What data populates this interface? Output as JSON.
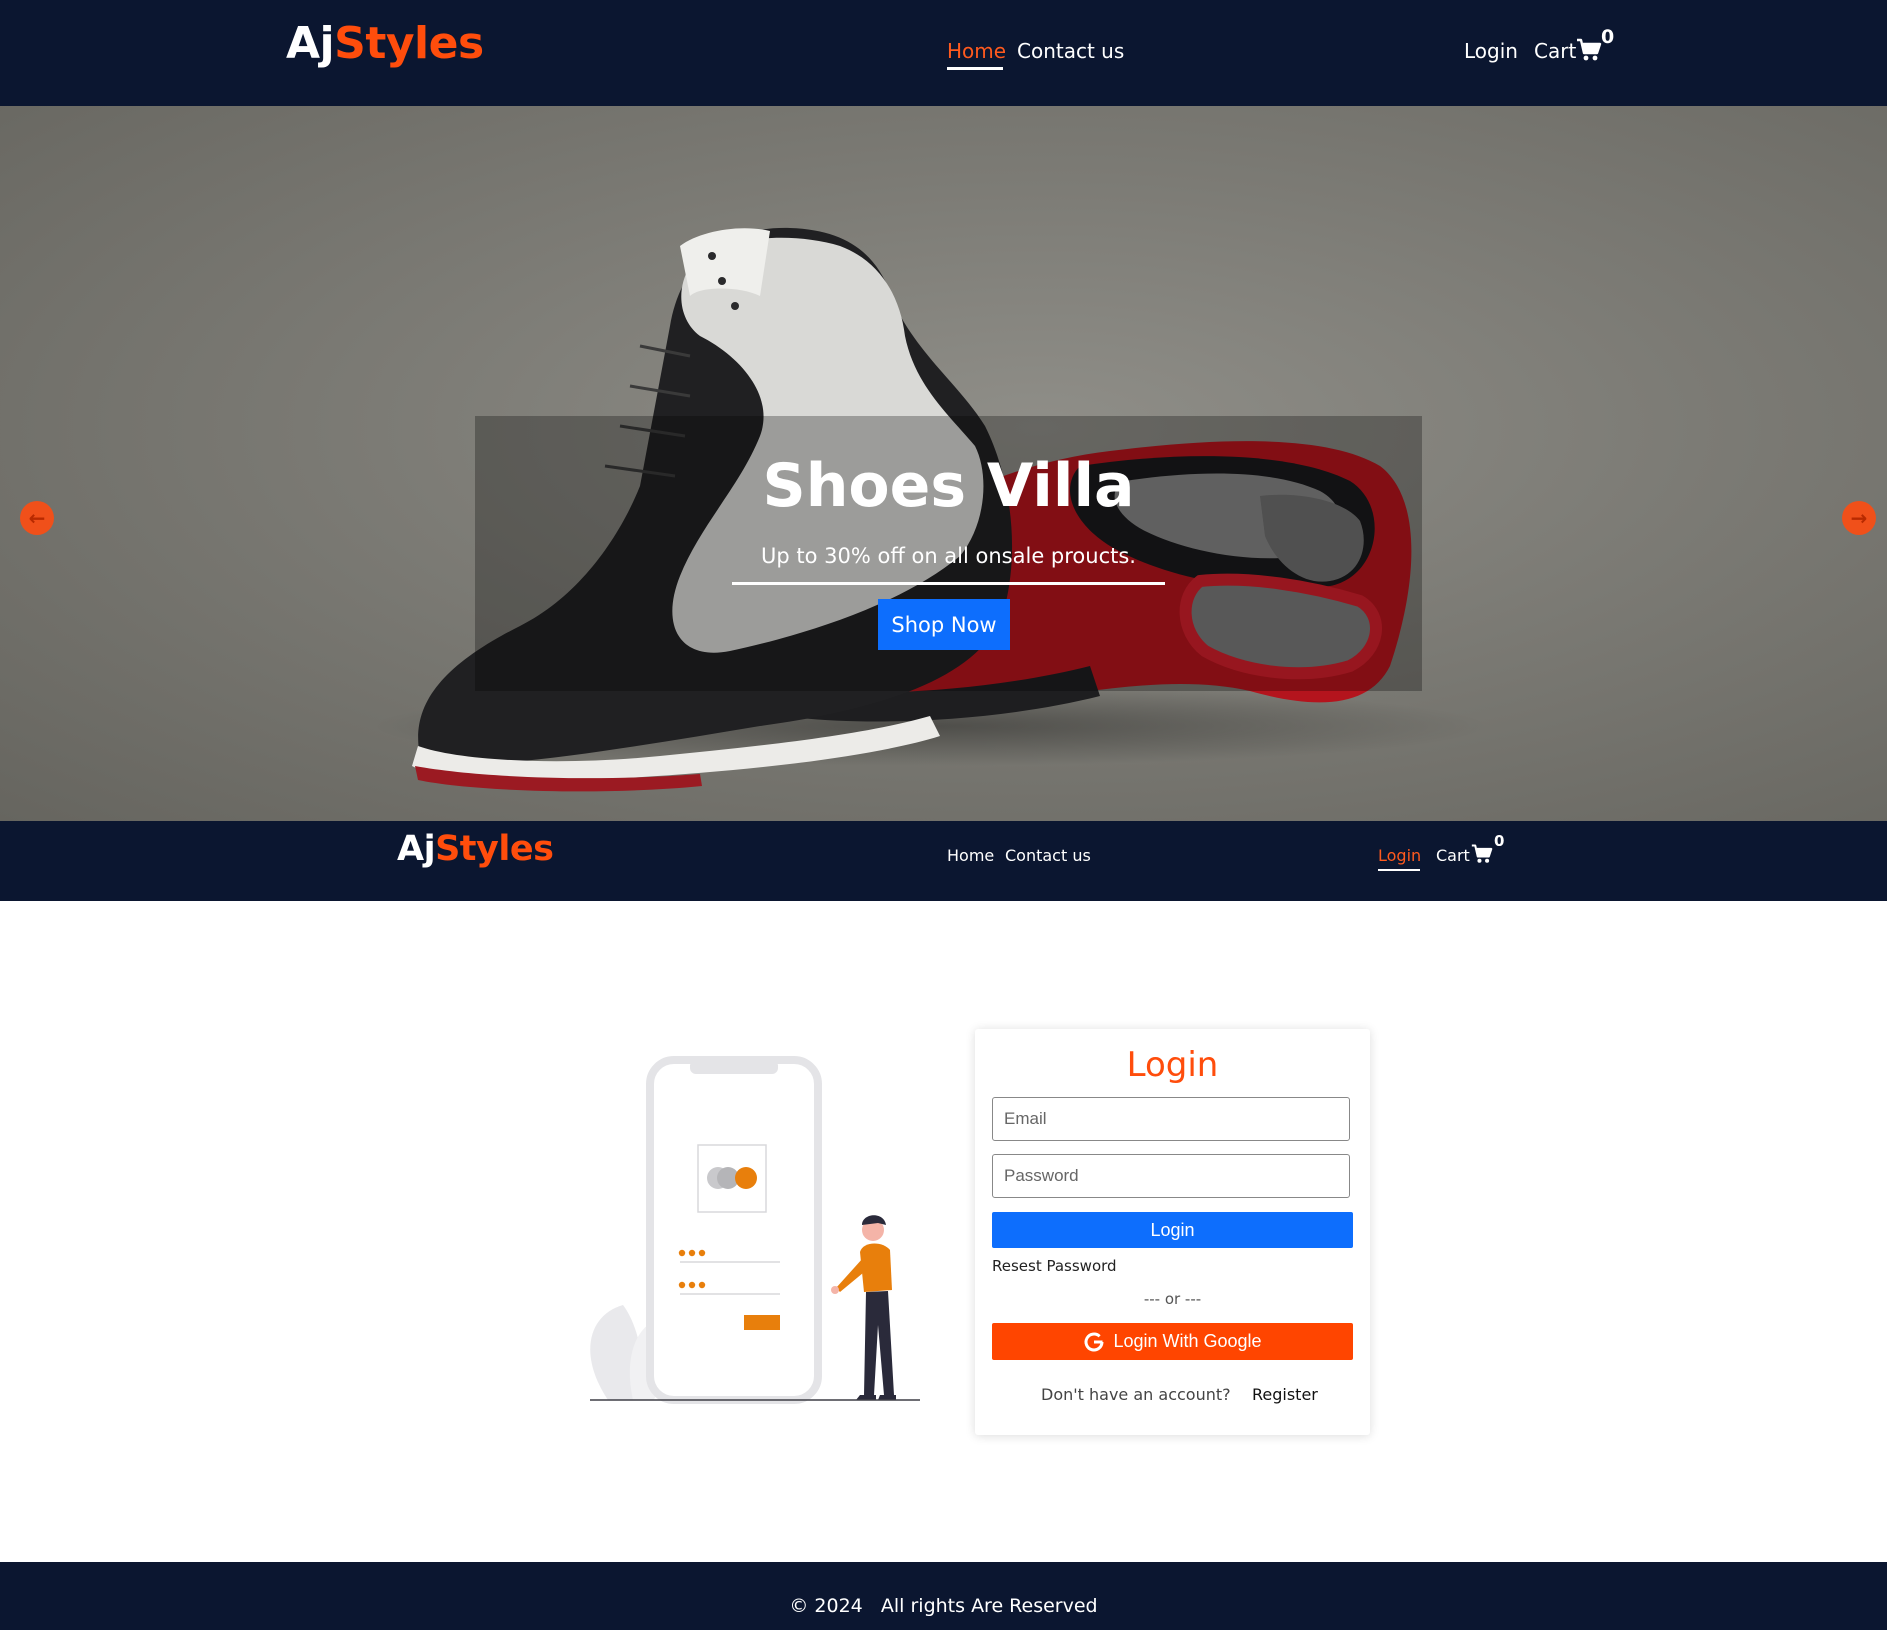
{
  "top_nav": {
    "brand_part1": "Aj",
    "brand_part2": "Styles",
    "links": [
      "Home",
      "Contact us"
    ],
    "login": "Login",
    "cart": "Cart",
    "cart_count": "0",
    "active_link": "Home"
  },
  "hero": {
    "title": "Shoes Villa",
    "subtitle": "Up to 30% off on all onsale proucts.",
    "button": "Shop Now",
    "prev_icon": "arrow-left-icon",
    "next_icon": "arrow-right-icon"
  },
  "sub_nav": {
    "brand_part1": "Aj",
    "brand_part2": "Styles",
    "links": [
      "Home",
      "Contact us"
    ],
    "login": "Login",
    "cart": "Cart",
    "cart_count": "0",
    "active_link": "Login"
  },
  "login_form": {
    "title": "Login",
    "email_placeholder": "Email",
    "password_placeholder": "Password",
    "login_button": "Login",
    "reset_link": "Resest Password",
    "divider": "--- or ---",
    "google_button": "Login With Google",
    "no_account": "Don't have an account?",
    "register_link": "Register"
  },
  "footer": {
    "copyright": "© 2024   All rights Are Reserved"
  },
  "colors": {
    "navy": "#0b1630",
    "accent_orange": "#ff4d0c",
    "primary_blue": "#0d6efd",
    "google_orange": "#ff4500"
  }
}
